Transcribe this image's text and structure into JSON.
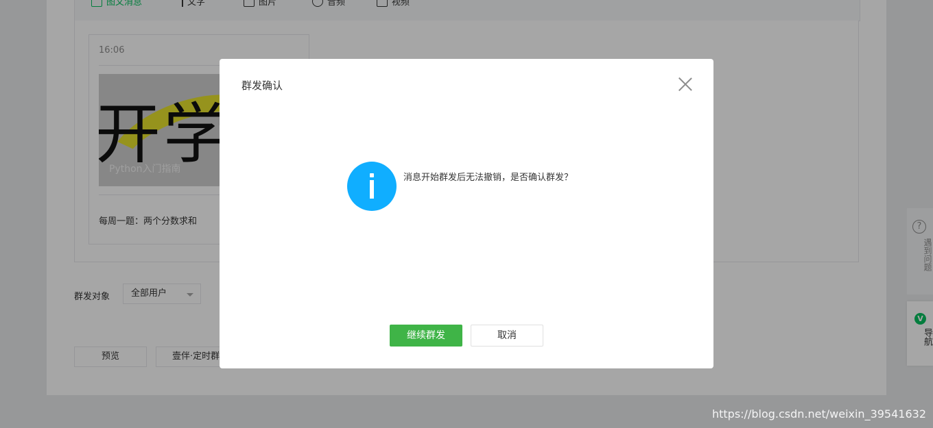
{
  "tabs": [
    {
      "label": "图文消息",
      "icon": "article-icon"
    },
    {
      "label": "文字",
      "icon": "text-icon"
    },
    {
      "label": "图片",
      "icon": "image-icon"
    },
    {
      "label": "音频",
      "icon": "audio-icon"
    },
    {
      "label": "视频",
      "icon": "video-icon"
    }
  ],
  "message_card": {
    "time": "16:06",
    "cover_text": "开学",
    "cover_caption": "Python入门指南",
    "title": "每周一题：两个分数求和"
  },
  "send_target": {
    "label": "群发对象",
    "selected": "全部用户"
  },
  "actions": {
    "preview": "预览",
    "scheduled": "壹伴·定时群"
  },
  "dialog": {
    "title": "群发确认",
    "message": "消息开始群发后无法撤销，是否确认群发？",
    "confirm": "继续群发",
    "cancel": "取消"
  },
  "side_help": {
    "label": "遇到问题"
  },
  "side_nav": {
    "label": "导航"
  },
  "watermark": "https://blog.csdn.net/weixin_39541632",
  "colors": {
    "primary": "#3fb447",
    "info": "#10aeff",
    "accent_green": "#07c160"
  }
}
